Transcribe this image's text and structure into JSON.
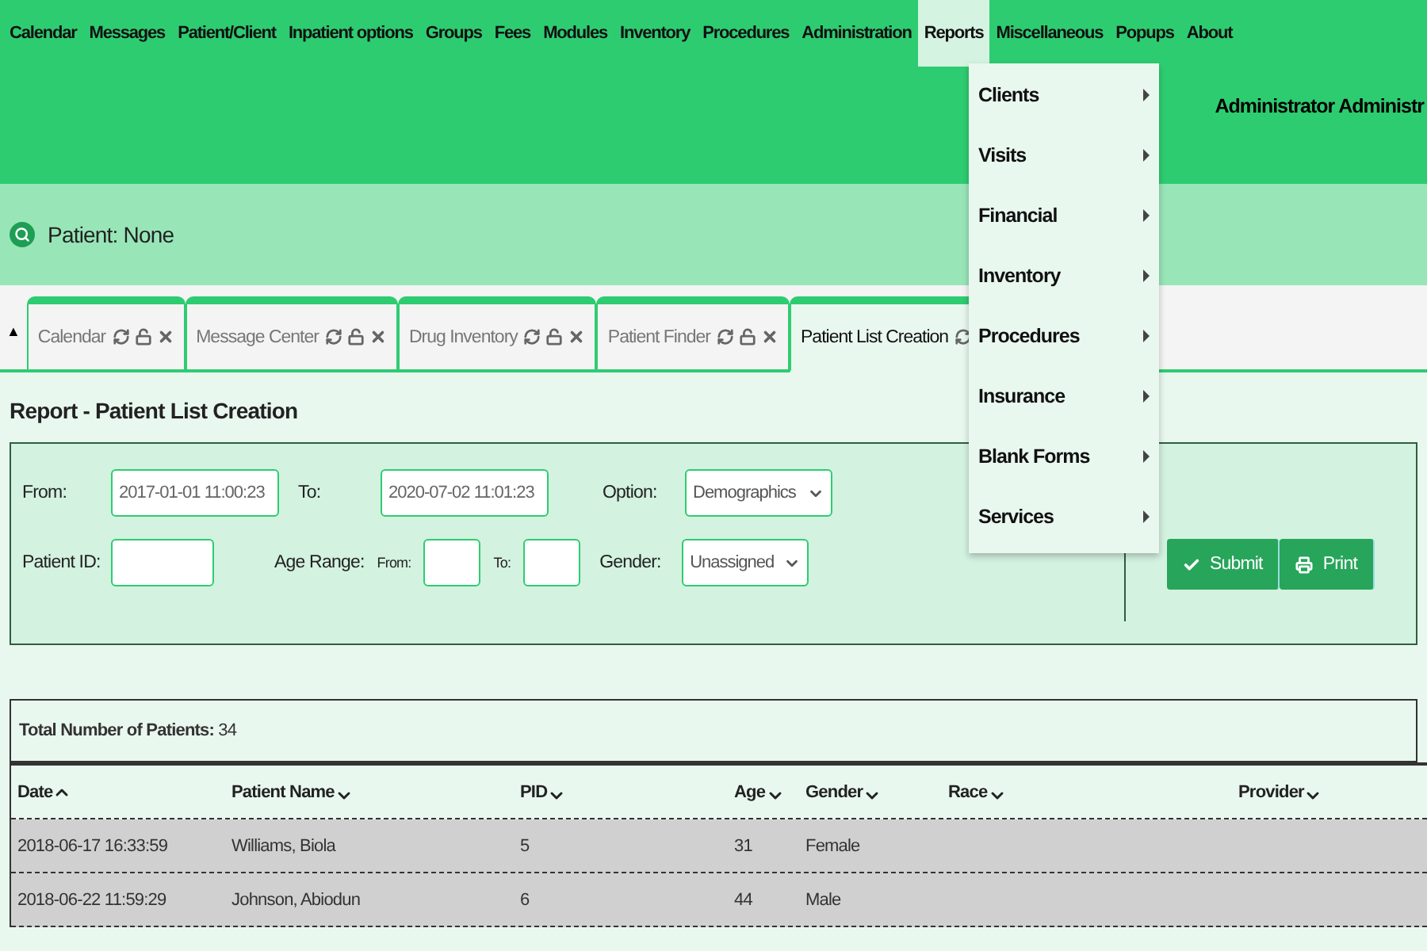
{
  "menu_bar": [
    {
      "label": "Calendar",
      "selected": false
    },
    {
      "label": "Messages",
      "selected": false
    },
    {
      "label": "Patient/Client",
      "selected": false
    },
    {
      "label": "Inpatient options",
      "selected": false
    },
    {
      "label": "Groups",
      "selected": false
    },
    {
      "label": "Fees",
      "selected": false
    },
    {
      "label": "Modules",
      "selected": false
    },
    {
      "label": "Inventory",
      "selected": false
    },
    {
      "label": "Procedures",
      "selected": false
    },
    {
      "label": "Administration",
      "selected": false
    },
    {
      "label": "Reports",
      "selected": true
    },
    {
      "label": "Miscellaneous",
      "selected": false
    },
    {
      "label": "Popups",
      "selected": false
    },
    {
      "label": "About",
      "selected": false
    }
  ],
  "user": "Administrator Administr",
  "reports_menu": [
    "Clients",
    "Visits",
    "Financial",
    "Inventory",
    "Procedures",
    "Insurance",
    "Blank Forms",
    "Services"
  ],
  "patient_bar": {
    "label": "Patient: None"
  },
  "collapse_toggle": "▲",
  "tabs": [
    {
      "label": "Calendar",
      "selected": false
    },
    {
      "label": "Message Center",
      "selected": false
    },
    {
      "label": "Drug Inventory",
      "selected": false
    },
    {
      "label": "Patient Finder",
      "selected": false
    },
    {
      "label": "Patient List Creation",
      "selected": true
    }
  ],
  "page_title": "Report - Patient List Creation",
  "form": {
    "from_label": "From:",
    "from_value": "2017-01-01 11:00:23",
    "to_label": "To:",
    "to_value": "2020-07-02 11:01:23",
    "option_label": "Option:",
    "option_value": "Demographics",
    "patient_id_label": "Patient ID:",
    "age_range_label": "Age Range:",
    "age_from_label": "From:",
    "age_to_label": "To:",
    "gender_label": "Gender:",
    "gender_value": "Unassigned"
  },
  "buttons": [
    "Submit",
    "Print"
  ],
  "total": {
    "label": "Total Number of Patients:",
    "value": "34"
  },
  "table": {
    "columns": [
      {
        "label": "Date",
        "sort_ascending": true
      },
      {
        "label": "Patient Name",
        "sort_ascending": false
      },
      {
        "label": "PID",
        "sort_ascending": false
      },
      {
        "label": "Age",
        "sort_ascending": false
      },
      {
        "label": "Gender",
        "sort_ascending": false
      },
      {
        "label": "Race",
        "sort_ascending": false
      },
      {
        "label": "Provider",
        "sort_ascending": false
      }
    ],
    "rows": [
      [
        "2018-06-17 16:33:59",
        "Williams, Biola",
        "5",
        "31",
        "Female",
        "",
        ""
      ],
      [
        "2018-06-22 11:59:29",
        "Johnson, Abiodun",
        "6",
        "44",
        "Male",
        "",
        ""
      ]
    ]
  }
}
